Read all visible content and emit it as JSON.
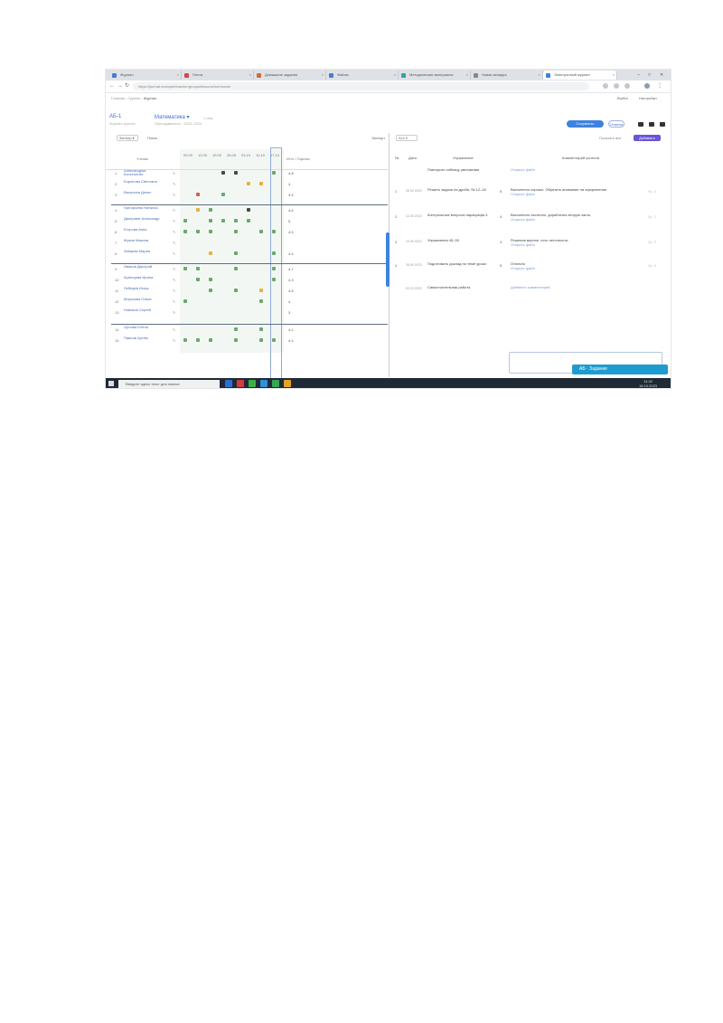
{
  "browser": {
    "tabs": [
      {
        "label": "Журнал",
        "color": "#4a7bd0"
      },
      {
        "label": "Почта",
        "color": "#d04a4a"
      },
      {
        "label": "Домашние задания",
        "color": "#d06a3a"
      },
      {
        "label": "Файлы",
        "color": "#4a7bd0"
      },
      {
        "label": "Методические материалы",
        "color": "#3aa0a0"
      },
      {
        "label": "Новая вкладка",
        "color": "#888888"
      },
      {
        "label": "Электронный журнал",
        "color": "#3d82e0"
      }
    ],
    "url": "https://journal.example/teacher/groups/lessons/homework",
    "window_controls": [
      "–",
      "□",
      "✕"
    ]
  },
  "app": {
    "breadcrumb": [
      "Главная",
      "Группы",
      "Журнал"
    ],
    "header_right": [
      "Выйти",
      "Настройки"
    ],
    "left_title": "АБ-1",
    "left_subtitle": "Журнал группы",
    "mid_title": "Математика ▾",
    "mid_title_small": "1 сем",
    "mid_subtitle": "Преподаватель · 2023–2024",
    "primary_button": "Сохранить",
    "secondary_button": "Отмена"
  },
  "grid": {
    "filter_label": "Фильтр ▾",
    "search_label": "Поиск",
    "right_tool": "Экспорт",
    "col_name": "Ученик",
    "col_total": "Итог / Оценка",
    "date_headers": [
      "05.09",
      "12.09",
      "19.09",
      "26.09",
      "03.10",
      "10.10",
      "17.10"
    ],
    "rows": [
      {
        "num": "1",
        "name": "Александров Константин",
        "cells": [
          "",
          "",
          "",
          "dark",
          "dark",
          "",
          "",
          "green"
        ],
        "total": "4.8"
      },
      {
        "num": "2",
        "name": "Борисова Светлана",
        "cells": [
          "",
          "",
          "",
          "",
          "",
          "amber",
          "amber",
          ""
        ],
        "total": "4"
      },
      {
        "num": "3",
        "name": "Васильев Денис",
        "cells": [
          "",
          "red",
          "",
          "green",
          "",
          "",
          "",
          ""
        ],
        "total": "3.5"
      },
      {
        "num": "4",
        "name": "Григорьева Наталья",
        "cells": [
          "",
          "amber",
          "green",
          "",
          "",
          "dark",
          "",
          ""
        ],
        "total": "4.6"
      },
      {
        "num": "5",
        "name": "Дмитриев Александр",
        "cells": [
          "green",
          "",
          "green",
          "green",
          "green",
          "green",
          "",
          ""
        ],
        "total": "5"
      },
      {
        "num": "6",
        "name": "Егорова Анна",
        "cells": [
          "green",
          "green",
          "green",
          "",
          "green",
          "",
          "green",
          "green"
        ],
        "total": "4.5"
      },
      {
        "num": "7",
        "name": "Жуков Максим",
        "cells": [
          "",
          "",
          "",
          "",
          "",
          "",
          "",
          ""
        ],
        "total": ""
      },
      {
        "num": "8",
        "name": "Зайцева Мария",
        "cells": [
          "",
          "",
          "amber",
          "",
          "green",
          "",
          "",
          "green"
        ],
        "total": "4.4"
      },
      {
        "num": "9",
        "name": "Иванов Дмитрий",
        "cells": [
          "green",
          "green",
          "",
          "",
          "green",
          "",
          "",
          "green"
        ],
        "total": "4.7"
      },
      {
        "num": "10",
        "name": "Кузнецова Ирина",
        "cells": [
          "",
          "green",
          "green",
          "",
          "",
          "",
          "",
          "green"
        ],
        "total": "4.3"
      },
      {
        "num": "11",
        "name": "Лебедев Игорь",
        "cells": [
          "",
          "",
          "green",
          "",
          "green",
          "",
          "amber",
          ""
        ],
        "total": "4.5"
      },
      {
        "num": "12",
        "name": "Морозова Ольга",
        "cells": [
          "green",
          "",
          "",
          "",
          "",
          "",
          "green",
          ""
        ],
        "total": "4"
      },
      {
        "num": "13",
        "name": "Новиков Сергей",
        "cells": [
          "",
          "",
          "",
          "",
          "",
          "",
          "",
          ""
        ],
        "total": "3"
      },
      {
        "num": "14",
        "name": "Орлова Елена",
        "cells": [
          "",
          "",
          "",
          "",
          "green",
          "",
          "green",
          ""
        ],
        "total": "4.1"
      },
      {
        "num": "15",
        "name": "Павлов Артём",
        "cells": [
          "green",
          "green",
          "green",
          "",
          "green",
          "",
          "green",
          "green"
        ],
        "total": "4.4"
      }
    ]
  },
  "homework": {
    "select_label": "Все ▾",
    "link_label": "Показать все",
    "button_label": "Добавить",
    "headers": [
      "№",
      "Дата",
      "Упражнение",
      "Комментарий учителя"
    ],
    "rows": [
      {
        "idx": "",
        "date": "",
        "exercise": "Повторить таблицу умножения",
        "mark": "",
        "comment": "",
        "link": "Открыть файл"
      },
      {
        "idx": "1",
        "date": "05.09 2023",
        "exercise": "Решить задачи на дроби, № 12–18",
        "mark": "5",
        "comment": "Выполнено хорошо. Обратить внимание на оформление.",
        "link": "Открыть файл",
        "level": "Ур. 2"
      },
      {
        "idx": "2",
        "date": "12.09 2023",
        "exercise": "Контрольные вопросы параграфа 3",
        "mark": "4",
        "comment": "Выполнено частично, доработать вторую часть.",
        "link": "Открыть файл",
        "level": "Ур. 1"
      },
      {
        "idx": "3",
        "date": "19.09 2023",
        "exercise": "Упражнения 45–50",
        "mark": "4",
        "comment": "Решение верное, есть неточности.",
        "link": "Открыть файл",
        "level": "Ур. 2"
      },
      {
        "idx": "4",
        "date": "26.09 2023",
        "exercise": "Подготовить доклад по теме урока",
        "mark": "5",
        "comment": "Отлично",
        "link": "Открыть файл",
        "level": "Ур. 3"
      },
      {
        "idx": "",
        "date": "03.10 2023",
        "exercise": "Самостоятельная работа",
        "mark": "",
        "comment": "",
        "link": "Добавить комментарий"
      }
    ],
    "bottom_pill": "АБ · Задание"
  },
  "taskbar": {
    "search": "Введите здесь текст для поиска",
    "apps": [
      "#2a6fd6",
      "#d63b3b",
      "#3cb043",
      "#2e90d6",
      "#33a853",
      "#e6a323"
    ],
    "time": "14:32",
    "date": "18.10.2023"
  }
}
